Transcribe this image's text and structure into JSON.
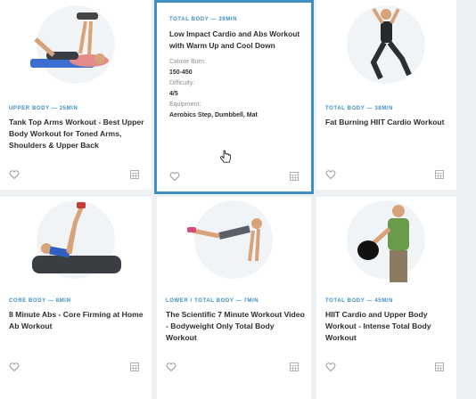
{
  "cards": [
    {
      "category": "UPPER BODY — 25MIN",
      "title": "Tank Top Arms Workout - Best Upper Body Workout for Toned Arms, Shoulders & Upper Back",
      "image": "woman-dumbbell-press-on-mat",
      "favorite_icon": "heart-icon",
      "calendar_icon": "calendar-icon"
    },
    {
      "category": "TOTAL BODY — 39MIN",
      "title": "Low Impact Cardio and Abs Workout with Warm Up and Cool Down",
      "details": [
        {
          "label": "Calorie Burn:",
          "value": "150-450"
        },
        {
          "label": "Difficulty:",
          "value": "4/5"
        },
        {
          "label": "Equipment:",
          "value": "Aerobics Step, Dumbbell, Mat"
        }
      ],
      "favorite_icon": "heart-icon",
      "calendar_icon": "calendar-icon"
    },
    {
      "category": "TOTAL BODY — 38MIN",
      "title": "Fat Burning HIIT Cardio Workout",
      "image": "woman-lunge-jump",
      "favorite_icon": "heart-icon",
      "calendar_icon": "calendar-icon"
    },
    {
      "category": "CORE BODY — 8MIN",
      "title": "8 Minute Abs - Core Firming at Home Ab Workout",
      "image": "man-v-up-on-mat",
      "favorite_icon": "heart-icon",
      "calendar_icon": "calendar-icon"
    },
    {
      "category": "LOWER / TOTAL BODY — 7MIN",
      "title": "The Scientific 7 Minute Workout Video - Bodyweight Only Total Body Workout",
      "image": "woman-plank",
      "favorite_icon": "heart-icon",
      "calendar_icon": "calendar-icon"
    },
    {
      "category": "TOTAL BODY — 45MIN",
      "title": "HIIT Cardio and Upper Body Workout - Intense Total Body Workout",
      "image": "man-kettlebell-swing",
      "favorite_icon": "heart-icon",
      "calendar_icon": "calendar-icon"
    }
  ],
  "colors": {
    "accent": "#3d8fc4",
    "title": "#2b2f33",
    "muted": "#8a8f95",
    "background": "#eef1f4"
  }
}
